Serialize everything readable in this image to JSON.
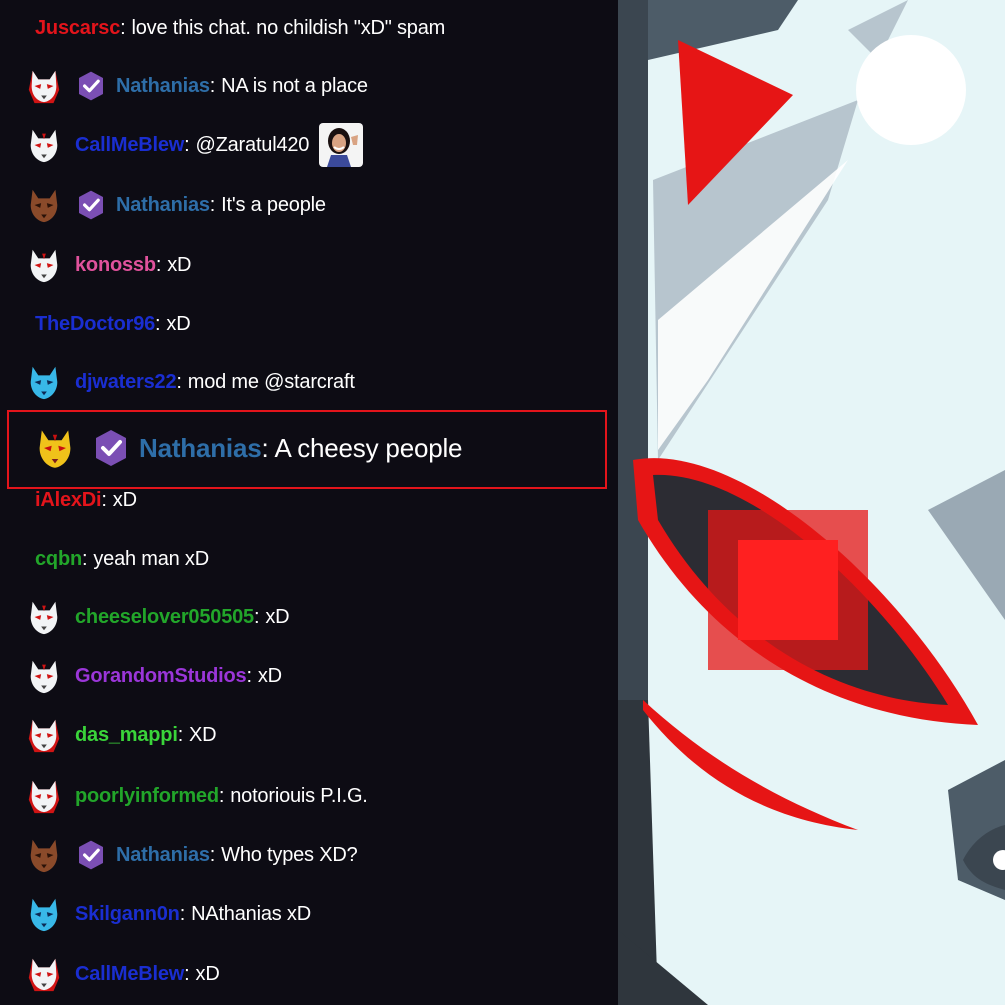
{
  "colors": {
    "red": "#e3141b",
    "blue": "#2e6ea8",
    "darkblue": "#1a2ed1",
    "pink": "#e0529c",
    "green": "#22a62a",
    "brightgreen": "#3ad43a",
    "purple": "#9b36d9",
    "verified": "#7b4fb4"
  },
  "messages": [
    {
      "user": "Juscarsc",
      "color": "#e3141b",
      "text": "love this chat. no childish \"xD\" spam",
      "mask": "none",
      "verified": false
    },
    {
      "user": "Nathanias",
      "color": "#2e6ea8",
      "text": "NA is not a place",
      "mask": "white-red",
      "verified": true
    },
    {
      "user": "CallMeBlew",
      "color": "#1a2ed1",
      "text": "@Zaratul420",
      "mask": "white",
      "verified": false,
      "emote": "waving-woman-emote"
    },
    {
      "user": "Nathanias",
      "color": "#2e6ea8",
      "text": "It's a people",
      "mask": "brown",
      "verified": true
    },
    {
      "user": "konossb",
      "color": "#e0529c",
      "text": "xD",
      "mask": "white",
      "verified": false
    },
    {
      "user": "TheDoctor96",
      "color": "#1a2ed1",
      "text": "xD",
      "mask": "none",
      "verified": false
    },
    {
      "user": "djwaters22",
      "color": "#1a2ed1",
      "text": "mod me @starcraft",
      "mask": "blue",
      "verified": false
    },
    {
      "user": "iAlexDi",
      "color": "#e3141b",
      "text": "xD",
      "mask": "none",
      "verified": false
    },
    {
      "user": "cqbn",
      "color": "#22a62a",
      "text": "yeah man xD",
      "mask": "none",
      "verified": false
    },
    {
      "user": "cheeselover050505",
      "color": "#22a62a",
      "text": "xD",
      "mask": "white",
      "verified": false
    },
    {
      "user": "GorandomStudios",
      "color": "#9b36d9",
      "text": "xD",
      "mask": "white",
      "verified": false
    },
    {
      "user": "das_mappi",
      "color": "#3ad43a",
      "text": "XD",
      "mask": "white-red",
      "verified": false
    },
    {
      "user": "poorlyinformed",
      "color": "#22a62a",
      "text": "notoriouis P.I.G.",
      "mask": "white-red",
      "verified": false
    },
    {
      "user": "Nathanias",
      "color": "#2e6ea8",
      "text": "Who types XD?",
      "mask": "brown",
      "verified": true
    },
    {
      "user": "Skilgann0n",
      "color": "#1a2ed1",
      "text": "NAthanias xD",
      "mask": "blue",
      "verified": false
    },
    {
      "user": "CallMeBlew",
      "color": "#1a2ed1",
      "text": "xD",
      "mask": "white-red",
      "verified": false
    }
  ],
  "highlight": {
    "user": "Nathanias",
    "color": "#2e6ea8",
    "text": "A cheesy people",
    "mask": "yellow",
    "verified": true
  },
  "art": {
    "description_icon": "kitsune-mask-closeup-icon"
  }
}
